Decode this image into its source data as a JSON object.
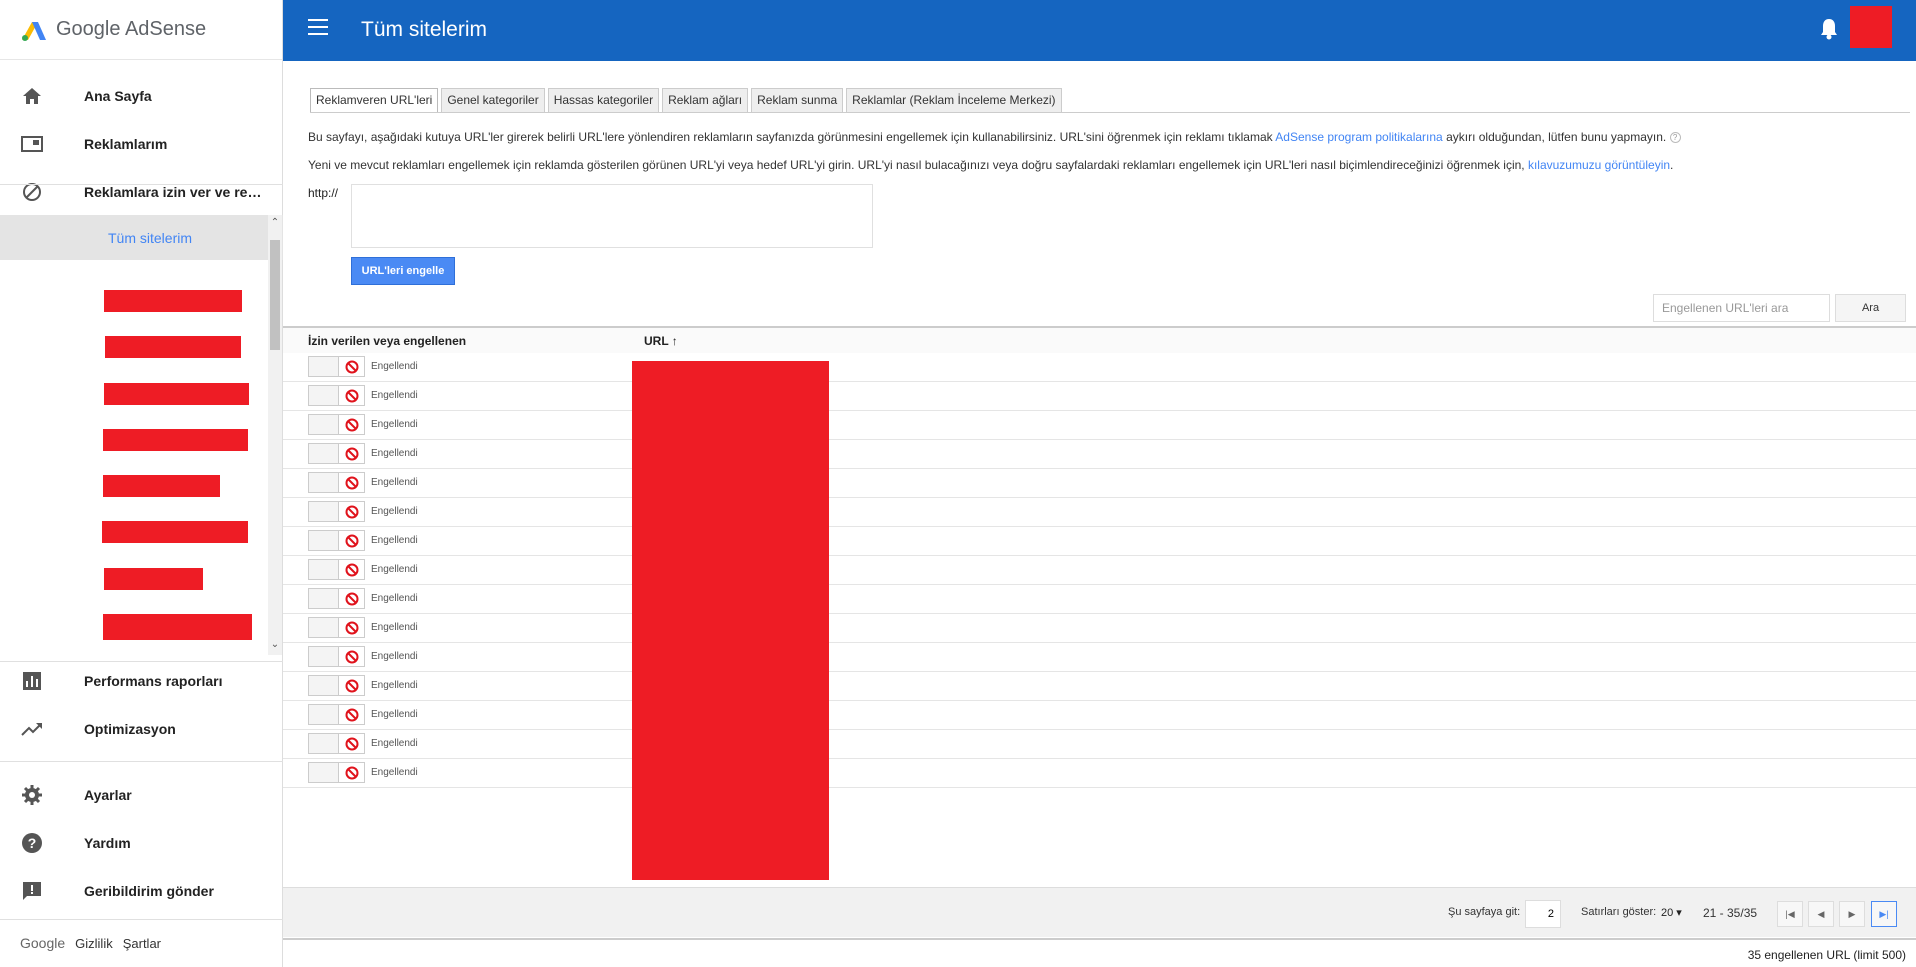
{
  "app": {
    "logo_text": "Google AdSense"
  },
  "header": {
    "title": "Tüm sitelerim"
  },
  "sidebar": {
    "items": [
      {
        "label": "Ana Sayfa",
        "icon": "home-icon"
      },
      {
        "label": "Reklamlarım",
        "icon": "ads-icon"
      },
      {
        "label": "Reklamlara izin ver ve rekl...",
        "icon": "block-icon"
      }
    ],
    "sites_selected": "Tüm sitelerim",
    "items_bottom": [
      {
        "label": "Performans raporları",
        "icon": "bar-chart-icon"
      },
      {
        "label": "Optimizasyon",
        "icon": "trending-up-icon"
      },
      {
        "label": "Ayarlar",
        "icon": "gear-icon"
      },
      {
        "label": "Yardım",
        "icon": "help-icon"
      },
      {
        "label": "Geribildirim gönder",
        "icon": "feedback-icon"
      }
    ],
    "footer": {
      "google": "Google",
      "privacy": "Gizlilik",
      "terms": "Şartlar"
    }
  },
  "tabs": [
    "Reklamveren URL'leri",
    "Genel kategoriler",
    "Hassas kategoriler",
    "Reklam ağları",
    "Reklam sunma",
    "Reklamlar (Reklam İnceleme Merkezi)"
  ],
  "intro": {
    "p1_before": "Bu sayfayı, aşağıdaki kutuya URL'ler girerek belirli URL'lere yönlendiren reklamların sayfanızda görünmesini engellemek için kullanabilirsiniz. URL'sini öğrenmek için reklamı tıklamak ",
    "p1_link": "AdSense program politikalarına",
    "p1_after": " aykırı olduğundan, lütfen bunu yapmayın.",
    "p1_help": "?",
    "p2_before": "Yeni ve mevcut reklamları engellemek için reklamda gösterilen görünen URL'yi veya hedef URL'yi girin. URL'yi nasıl bulacağınızı veya doğru sayfalardaki reklamları engellemek için URL'leri nasıl biçimlendireceğinizi öğrenmek için, ",
    "p2_link": "kılavuzumuzu görüntüleyin",
    "p2_after": "."
  },
  "form": {
    "http_label": "http://",
    "block_button": "URL'leri engelle"
  },
  "search": {
    "placeholder": "Engellenen URL'leri ara",
    "button": "Ara"
  },
  "table": {
    "col_status": "İzin verilen veya engellenen",
    "col_url": "URL",
    "sort_indicator": "↑",
    "rows": [
      "Engellendi",
      "Engellendi",
      "Engellendi",
      "Engellendi",
      "Engellendi",
      "Engellendi",
      "Engellendi",
      "Engellendi",
      "Engellendi",
      "Engellendi",
      "Engellendi",
      "Engellendi",
      "Engellendi",
      "Engellendi",
      "Engellendi"
    ]
  },
  "pager": {
    "go_to_label": "Şu sayfaya git:",
    "page_value": "2",
    "rows_label": "Satırları göster:",
    "rows_value": "20",
    "range": "21 - 35/35"
  },
  "status": {
    "summary": "35 engellenen URL (limit 500)"
  },
  "colors": {
    "header_bg": "#1565c0",
    "accent": "#4285f4",
    "redaction": "#ee1c25"
  }
}
